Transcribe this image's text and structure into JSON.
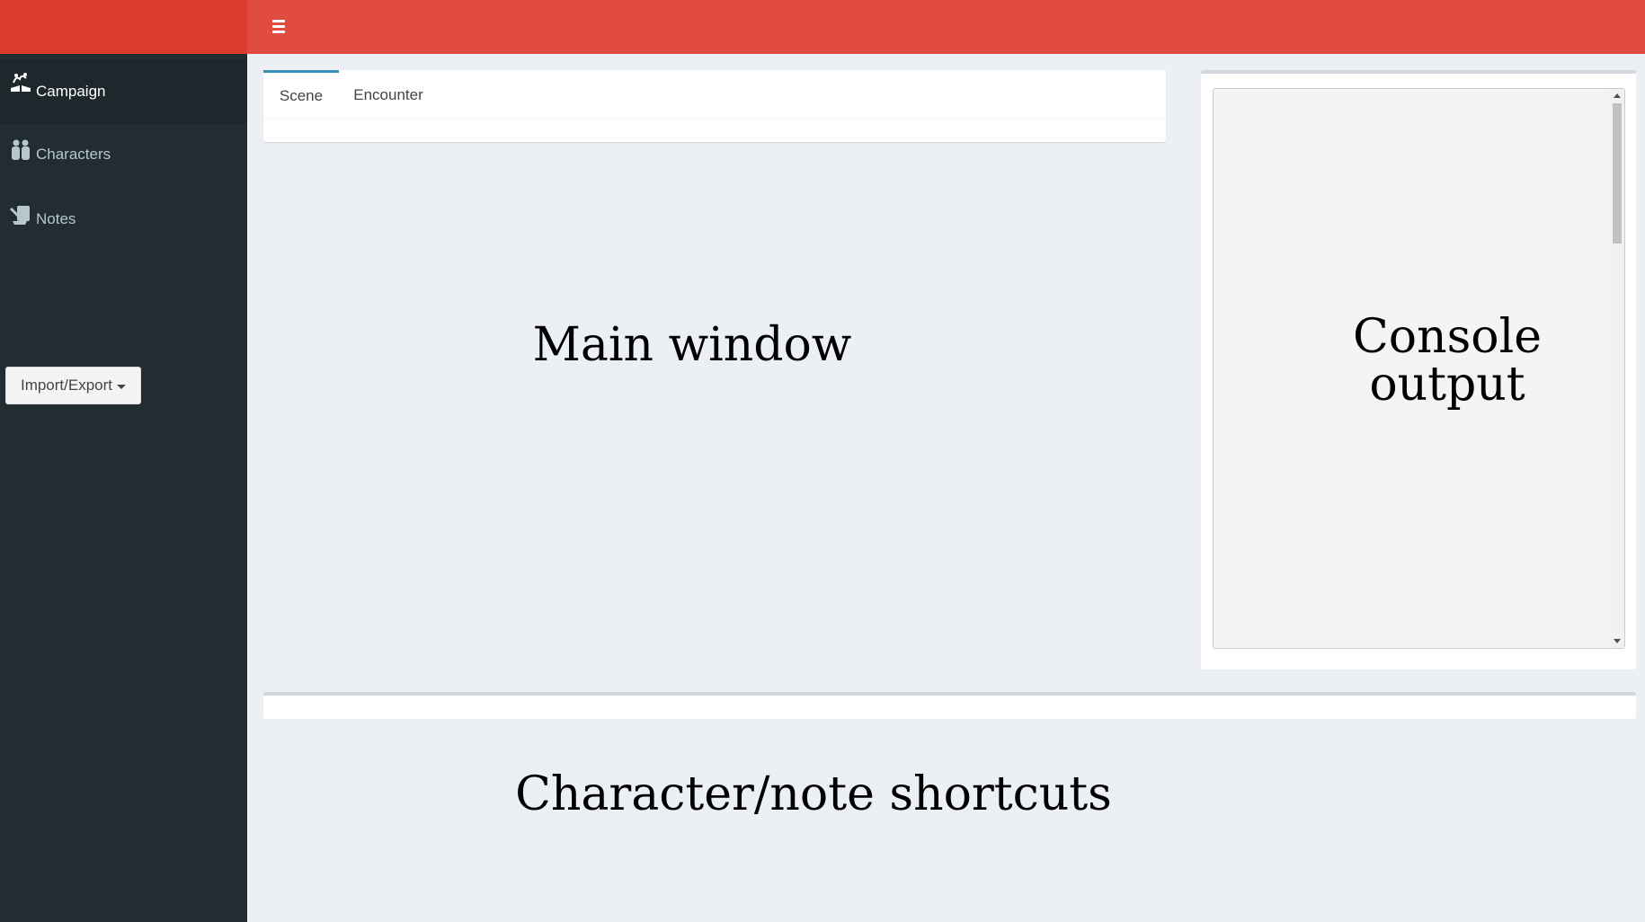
{
  "sidebar": {
    "items": [
      {
        "label": "Campaign",
        "icon": "campaign-icon",
        "active": true
      },
      {
        "label": "Characters",
        "icon": "characters-icon",
        "active": false
      },
      {
        "label": "Notes",
        "icon": "notes-icon",
        "active": false
      }
    ],
    "import_export_label": "Import/Export"
  },
  "header": {
    "toggle_icon": "hamburger-menu-icon"
  },
  "main": {
    "tabs": [
      {
        "label": "Scene",
        "active": true
      },
      {
        "label": "Encounter",
        "active": false
      }
    ]
  },
  "annotations": {
    "main_window": "Main  window",
    "console_line1": "Console",
    "console_line2": "output",
    "shortcuts": "Character/note  shortcuts"
  },
  "colors": {
    "header": "#e14c41",
    "logo": "#dd3b2f",
    "sidebar": "#222d32",
    "active_tab_accent": "#3c8dbc",
    "background": "#ecf0f5"
  }
}
